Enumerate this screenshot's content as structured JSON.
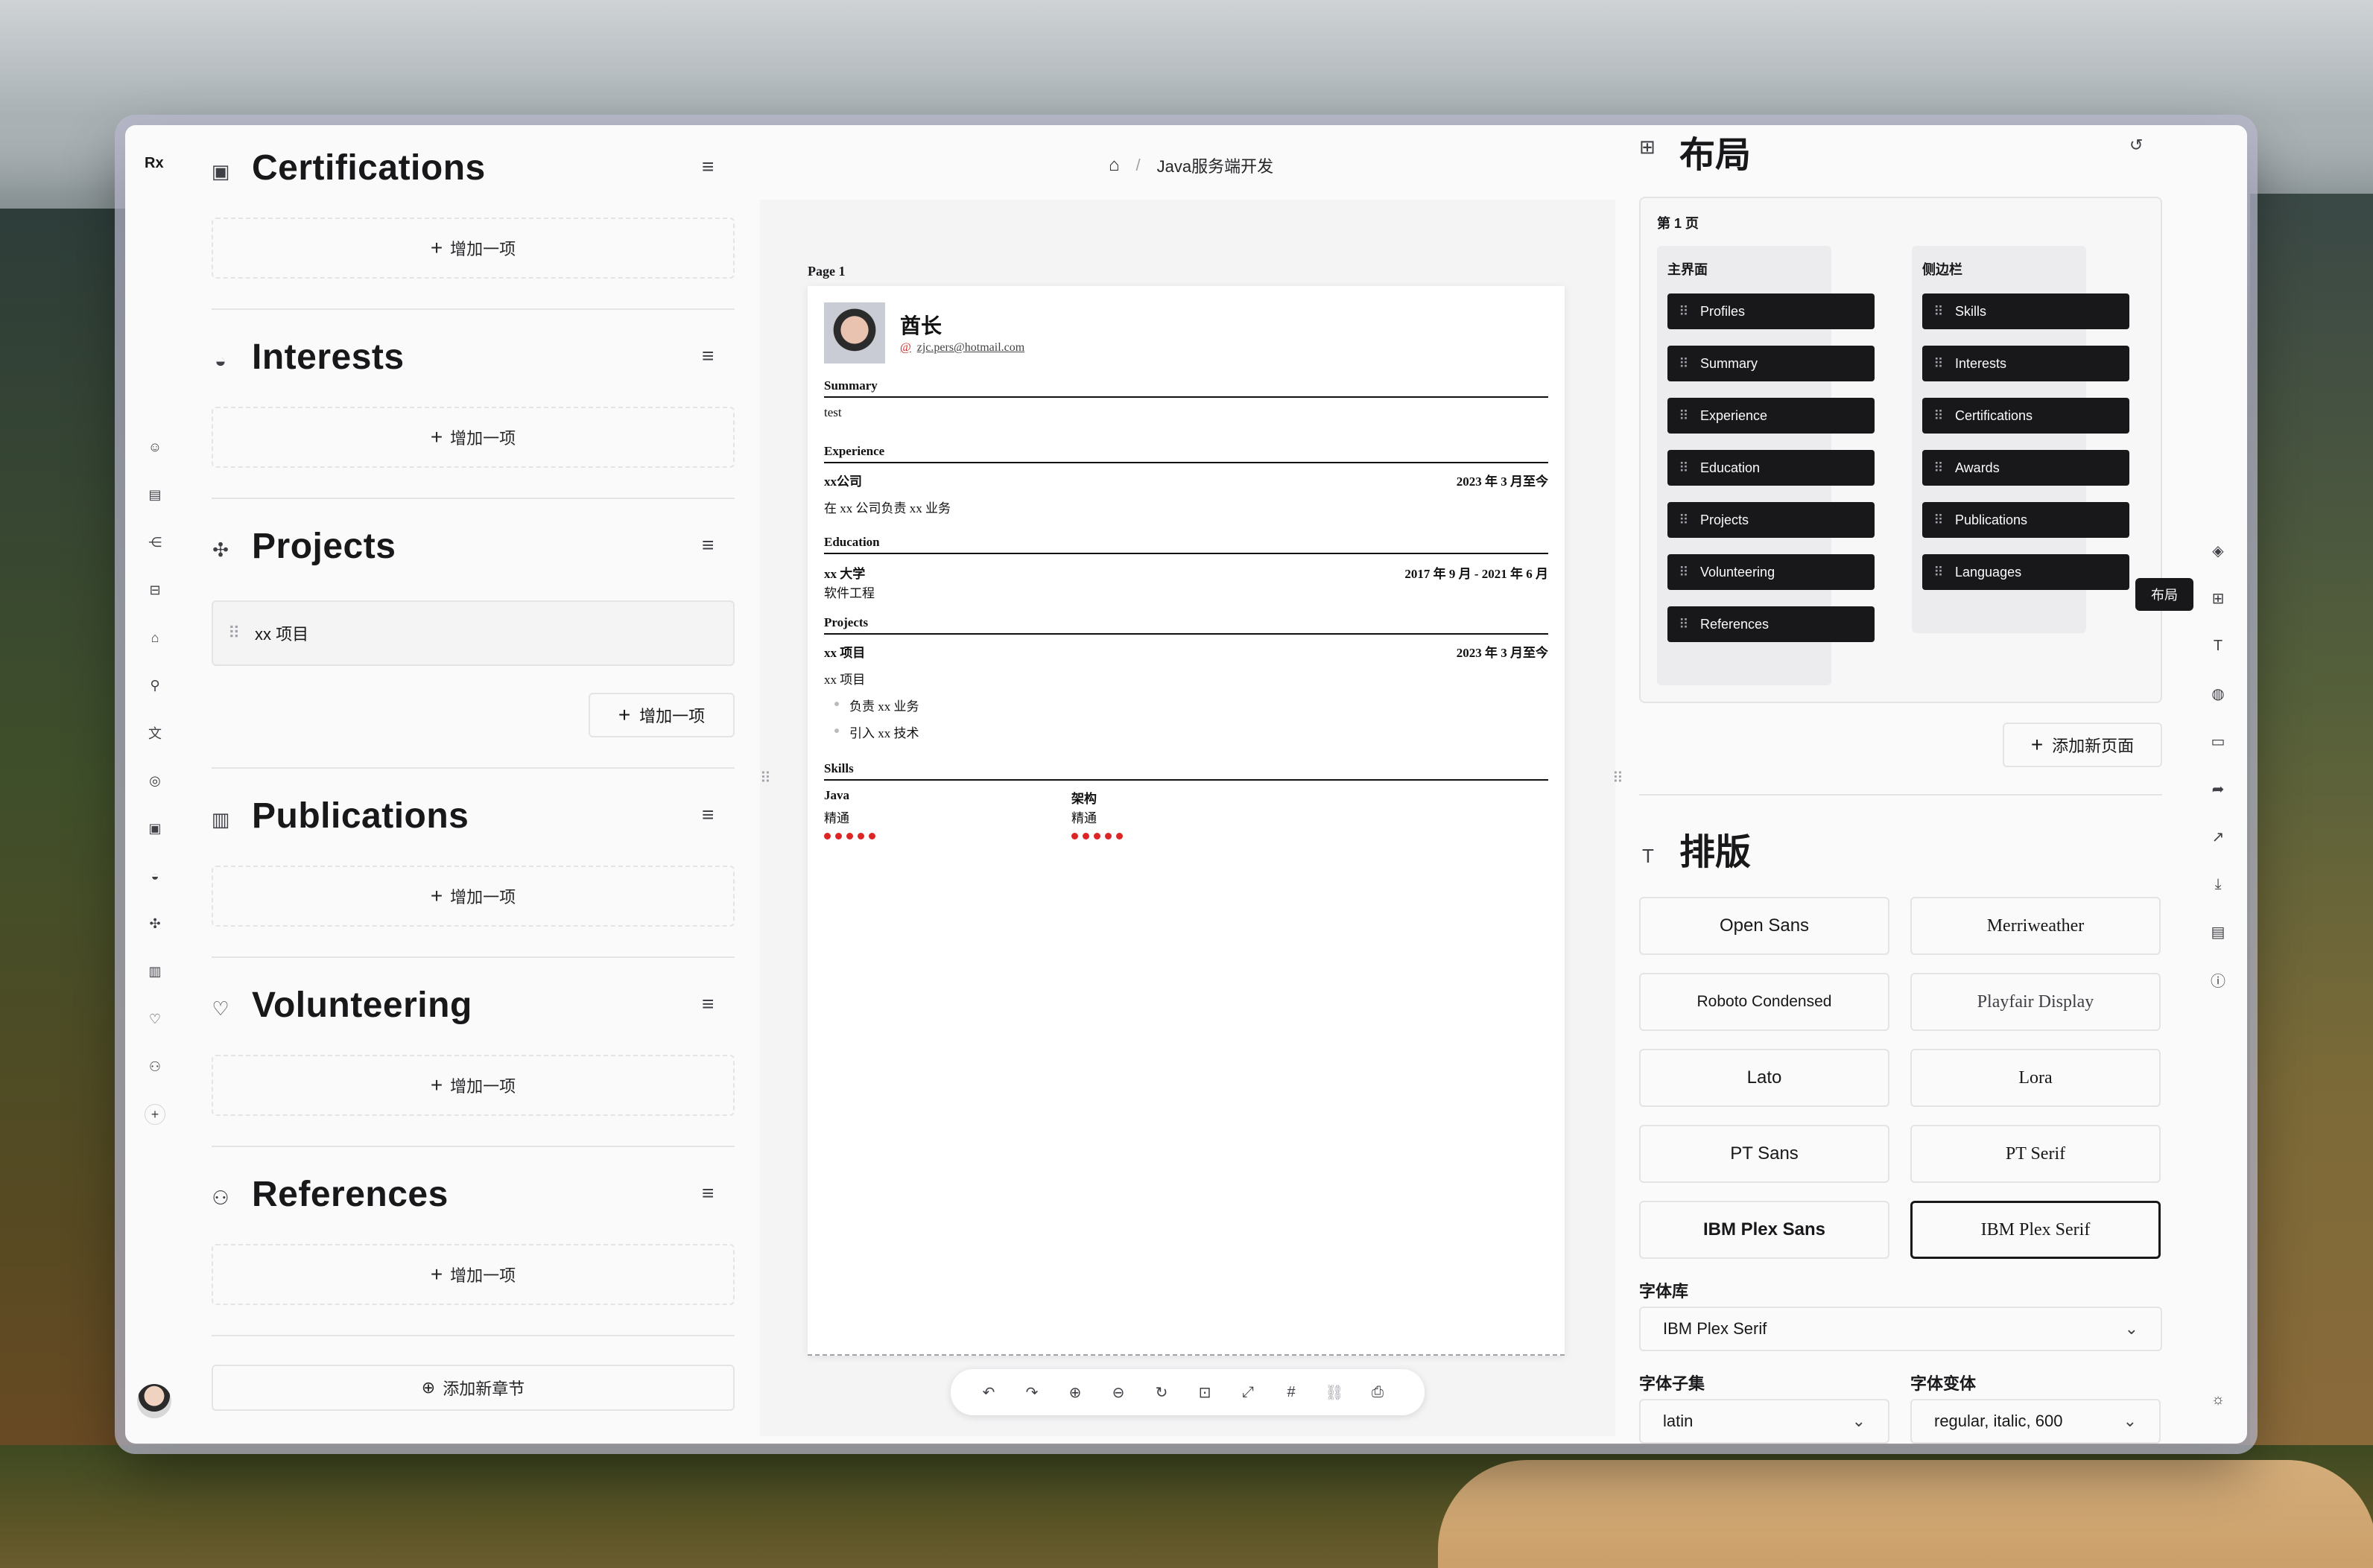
{
  "app": {
    "logo": "Rx",
    "breadcrumb_title": "Java服务端开发"
  },
  "sections": {
    "certifications": {
      "title": "Certifications",
      "add_label": "增加一项"
    },
    "interests": {
      "title": "Interests",
      "add_label": "增加一项"
    },
    "projects": {
      "title": "Projects",
      "item": "xx 项目",
      "add_label": "增加一项"
    },
    "publications": {
      "title": "Publications",
      "add_label": "增加一项"
    },
    "volunteering": {
      "title": "Volunteering",
      "add_label": "增加一项"
    },
    "references": {
      "title": "References",
      "add_label": "增加一项"
    },
    "add_section_label": "添加新章节"
  },
  "resume": {
    "page_label": "Page 1",
    "name": "酋长",
    "email": "zjc.pers@hotmail.com",
    "summary": {
      "heading": "Summary",
      "text": "test"
    },
    "experience": {
      "heading": "Experience",
      "company": "xx公司",
      "date": "2023 年 3 月至今",
      "desc": "在 xx 公司负责 xx 业务"
    },
    "education": {
      "heading": "Education",
      "school": "xx 大学",
      "date": "2017 年 9 月 - 2021 年 6 月",
      "major": "软件工程"
    },
    "projects": {
      "heading": "Projects",
      "name": "xx 项目",
      "date": "2023 年 3 月至今",
      "desc": "xx 项目",
      "bullets": [
        "负责 xx 业务",
        "引入 xx 技术"
      ]
    },
    "skills": {
      "heading": "Skills",
      "items": [
        {
          "name": "Java",
          "level": "精通",
          "rating": 5
        },
        {
          "name": "架构",
          "level": "精通",
          "rating": 5
        }
      ]
    }
  },
  "layout_panel": {
    "title": "布局",
    "page_name": "第 1 页",
    "main_title": "主界面",
    "sidebar_title": "侧边栏",
    "main_items": [
      "Profiles",
      "Summary",
      "Experience",
      "Education",
      "Projects",
      "Volunteering",
      "References"
    ],
    "sidebar_items": [
      "Skills",
      "Interests",
      "Certifications",
      "Awards",
      "Publications",
      "Languages"
    ],
    "add_page_label": "添加新页面",
    "tooltip": "布局"
  },
  "typography_panel": {
    "title": "排版",
    "fonts": [
      "Open Sans",
      "Merriweather",
      "Roboto Condensed",
      "Playfair Display",
      "Lato",
      "Lora",
      "PT Sans",
      "PT Serif",
      "IBM Plex Sans",
      "IBM Plex Serif"
    ],
    "selected_font": "IBM Plex Serif",
    "font_library_label": "字体库",
    "font_library_value": "IBM Plex Serif",
    "subset_label": "字体子集",
    "subset_value": "latin",
    "variant_label": "字体变体",
    "variant_value": "regular, italic, 600"
  },
  "colors": {
    "accent": "#dc2626",
    "chip_bg": "#18181b",
    "panel_bg": "#fafafa"
  }
}
